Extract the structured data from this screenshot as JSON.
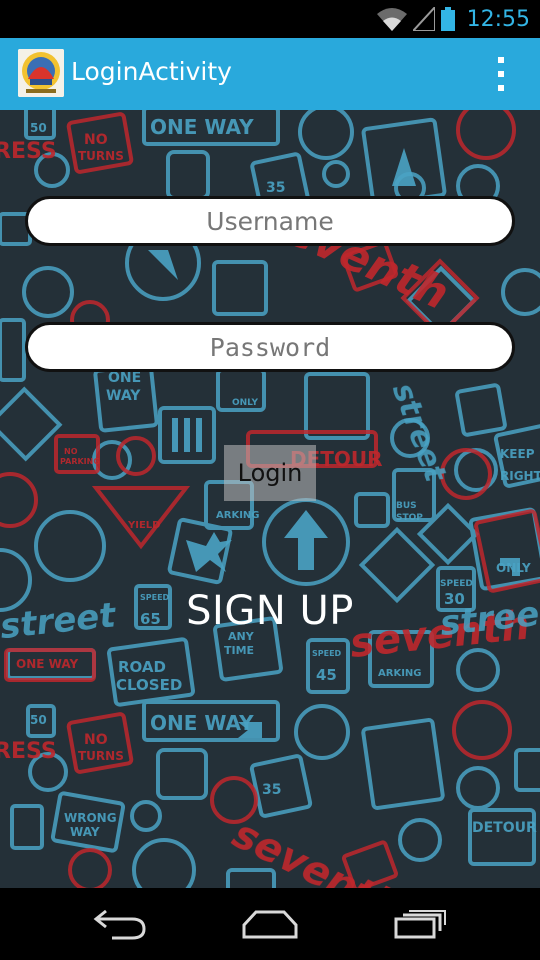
{
  "status_bar": {
    "time": "12:55",
    "icons": [
      "wifi-icon",
      "signal-icon",
      "battery-icon"
    ]
  },
  "action_bar": {
    "title": "LoginActivity",
    "color": "#29a9dc",
    "icons": [
      "app-logo-icon",
      "overflow-menu-icon"
    ]
  },
  "login_form": {
    "username_placeholder": "Username",
    "username_value": "",
    "password_placeholder": "Password",
    "password_value": "",
    "login_label": "Login",
    "signup_label": "SIGN UP"
  },
  "background": {
    "base_color": "#243038",
    "sign_blue": "#4aa3c4",
    "sign_red": "#c0282d",
    "sign_texts": [
      "ONE WAY",
      "NO TURNS",
      "DETOUR",
      "SPEED LIMIT 35",
      "SPEED LIMIT 30",
      "SPEED LIMIT 65",
      "SPEED LIMIT 45",
      "SPEED LIMIT 50",
      "ROAD CLOSED",
      "ANY TIME",
      "WRONG WAY",
      "BUS STOP",
      "KEEP RIGHT",
      "ONLY",
      "YIELD",
      "PARKING",
      "NO PARKING",
      "seventh",
      "street"
    ]
  },
  "nav_bar": {
    "icons": [
      "back-icon",
      "home-icon",
      "recent-apps-icon"
    ]
  }
}
